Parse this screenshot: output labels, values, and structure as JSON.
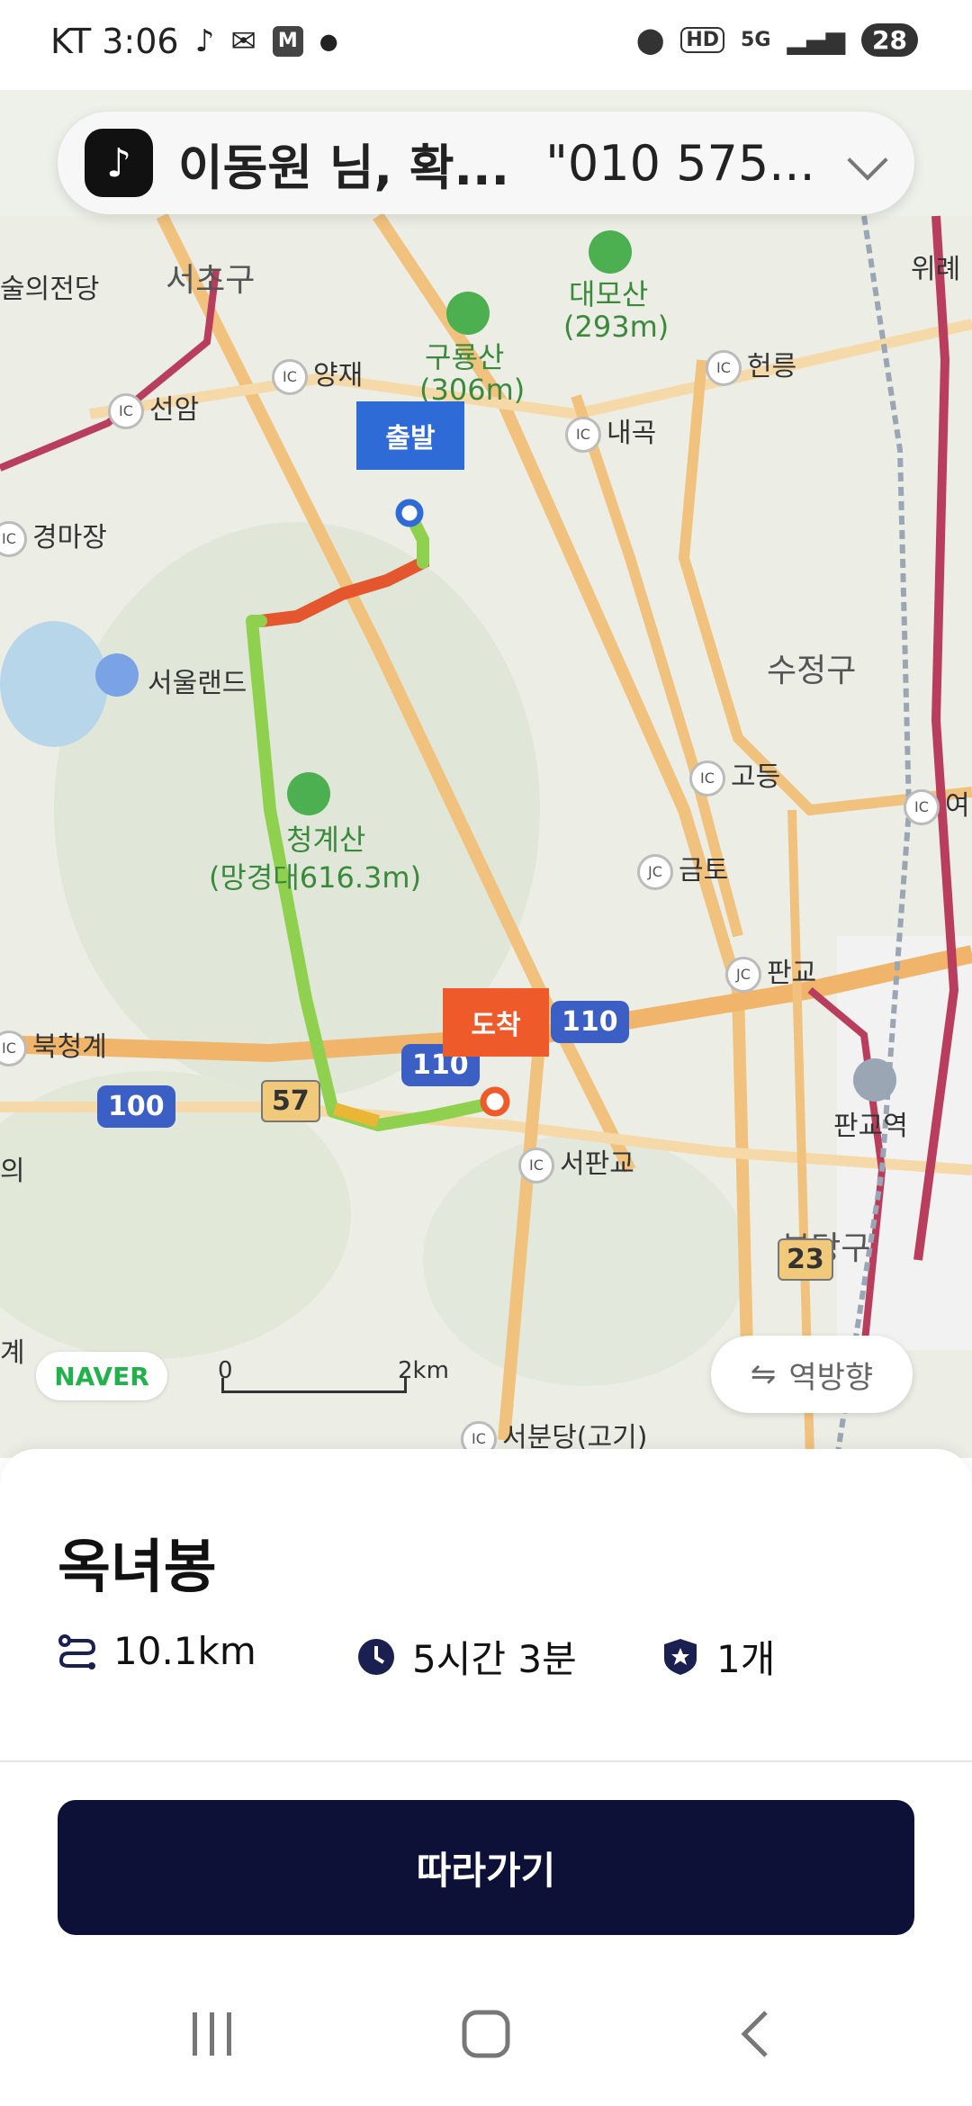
{
  "status_bar": {
    "carrier_time": "KT 3:06",
    "left_icons": [
      "tiktok-icon",
      "mail-icon",
      "m-app-icon",
      "dot-icon"
    ],
    "right_icons": [
      "location-icon",
      "hd-icon",
      "5g-icon",
      "signal-icon"
    ],
    "battery": "28"
  },
  "notification": {
    "app_icon": "tiktok-icon",
    "title": "이동원 님, 확...",
    "message": "\"010 575..."
  },
  "map": {
    "labels": {
      "art_center": "술의전당",
      "seocho": "서초구",
      "daemo": "대모산",
      "daemo_h": "(293m)",
      "guryong": "구룡산",
      "guryong_h": "(306m)",
      "wirye": "위례",
      "yangjae": "양재",
      "heolleung": "헌릉",
      "seonam": "선암",
      "naegok": "내곡",
      "gyeongmajang": "경마장",
      "seoulland": "서울랜드",
      "sujeong": "수정구",
      "godeung": "고등",
      "cheonggye": "청계산",
      "cheonggye_h": "(망경대616.3m)",
      "yeo": "여",
      "geumto": "금토",
      "pangyo_jc": "판교",
      "bukcheonggye": "북청계",
      "pangyo_station": "판교역",
      "seopangyo": "서판교",
      "bundang": "분당구",
      "seobundang": "서분당(고기)",
      "left_ui": "의",
      "left_gye": "계",
      "ic": "IC",
      "jc": "JC"
    },
    "shields": {
      "r110a": "110",
      "r110b": "110",
      "r100": "100",
      "r57": "57",
      "r23": "23"
    },
    "start_label": "출발",
    "end_label": "도착",
    "naver": "NAVER",
    "scale_zero": "0",
    "scale_km": "2km",
    "reverse_label": "역방향"
  },
  "route": {
    "name": "옥녀봉",
    "distance": "10.1km",
    "duration": "5시간 3분",
    "count": "1개"
  },
  "follow_button": "따라가기",
  "colors": {
    "route_green": "#8fd14f",
    "start_blue": "#2f6bd6",
    "end_orange": "#ef5a2a",
    "button_navy": "#0d1137"
  }
}
